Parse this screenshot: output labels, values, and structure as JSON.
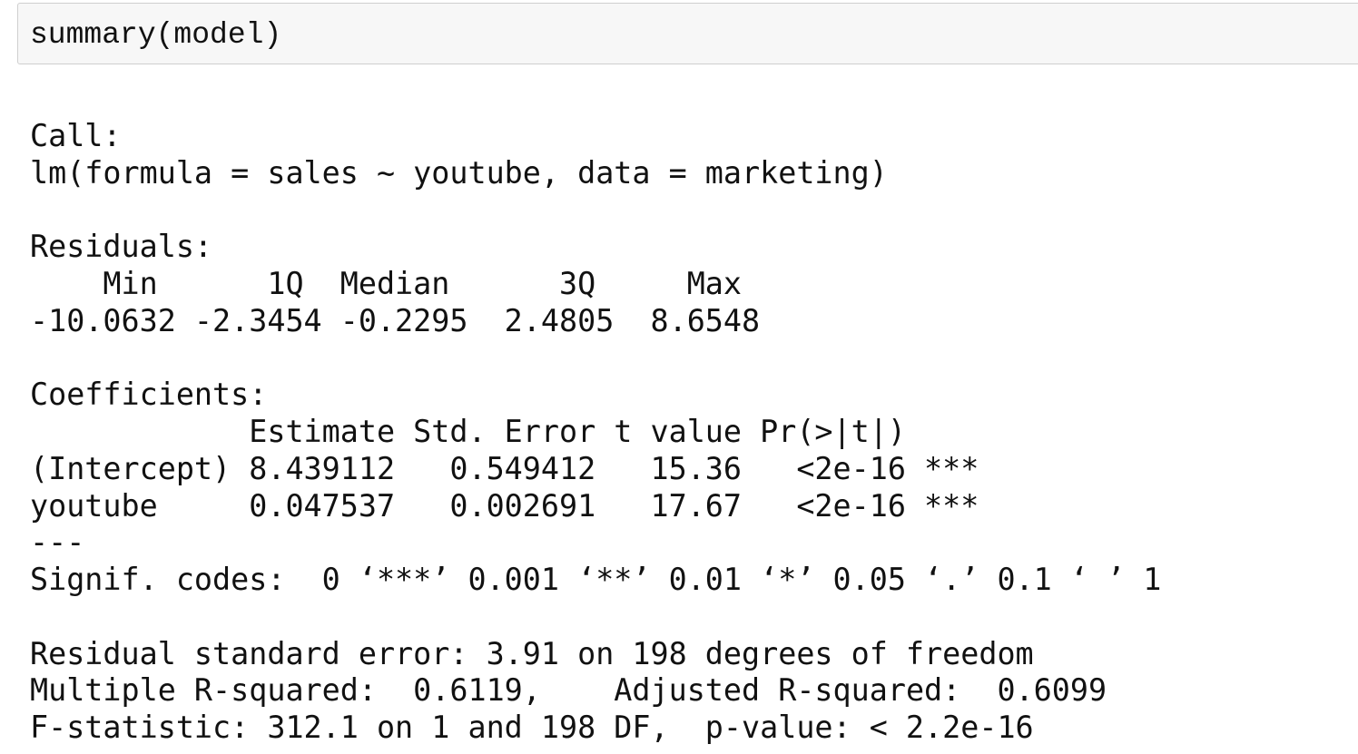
{
  "input_cell": {
    "code": "summary(model)"
  },
  "output": {
    "lines": [
      "",
      "Call:",
      "lm(formula = sales ~ youtube, data = marketing)",
      "",
      "Residuals:",
      "    Min      1Q  Median      3Q     Max ",
      "-10.0632 -2.3454 -0.2295  2.4805  8.6548 ",
      "",
      "Coefficients:",
      "            Estimate Std. Error t value Pr(>|t|)    ",
      "(Intercept) 8.439112   0.549412   15.36   <2e-16 ***",
      "youtube     0.047537   0.002691   17.67   <2e-16 ***",
      "---",
      "Signif. codes:  0 ‘***’ 0.001 ‘**’ 0.01 ‘*’ 0.05 ‘.’ 0.1 ‘ ’ 1",
      "",
      "Residual standard error: 3.91 on 198 degrees of freedom",
      "Multiple R-squared:  0.6119,\tAdjusted R-squared:  0.6099 ",
      "F-statistic: 312.1 on 1 and 198 DF,  p-value: < 2.2e-16"
    ]
  }
}
